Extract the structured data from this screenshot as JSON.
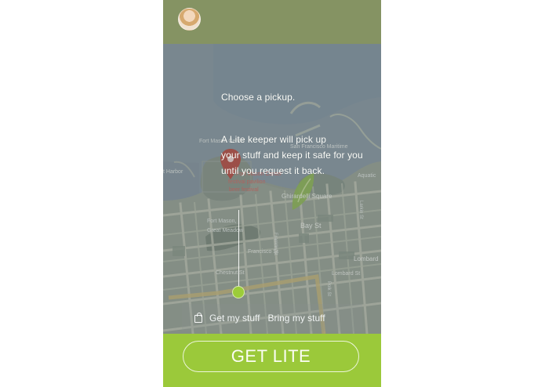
{
  "header": {
    "avatar": "user-avatar"
  },
  "overlay": {
    "heading": "Choose a pickup.",
    "line_1": "A Lite keeper will pick up",
    "line_2": "your stuff and keep it safe for you",
    "line_3": "until you request it back."
  },
  "map": {
    "labels": {
      "fort_mason_center": "Fort Mason Center",
      "festival_pavilion": "festival pavilion",
      "beer_festival": "beer festival",
      "ghirardelli_square": "Ghirardelli Square",
      "fort_mason": "Fort Mason,",
      "great_meadow": "Great Meadow",
      "bay_st": "Bay St",
      "francisco_st": "Francisco St",
      "chestnut_st": "Chestnut St",
      "lombard_st": "Lombard St",
      "lombard": "Lombard",
      "lombard_st_small": "Lombard St",
      "san_francisco_maritime": "San Francisco Maritime",
      "east_harbor": "t Harbor",
      "aquatic": "Aquatic",
      "larkin_st": "Larkin St",
      "polk_st": "Polk St",
      "van_ness_ave": "Van Ness Ave",
      "franklin_st": "Franklin St"
    }
  },
  "modes": {
    "get": "Get my stuff",
    "bring": "Bring my stuff"
  },
  "action": {
    "primary": "GET LITE"
  },
  "colors": {
    "accent": "#9bc93a",
    "header": "#849260",
    "overlay": "#707979"
  },
  "icons": {
    "bag": "bag-icon",
    "pin": "map-pin-icon",
    "dot": "pickup-dot-icon"
  }
}
